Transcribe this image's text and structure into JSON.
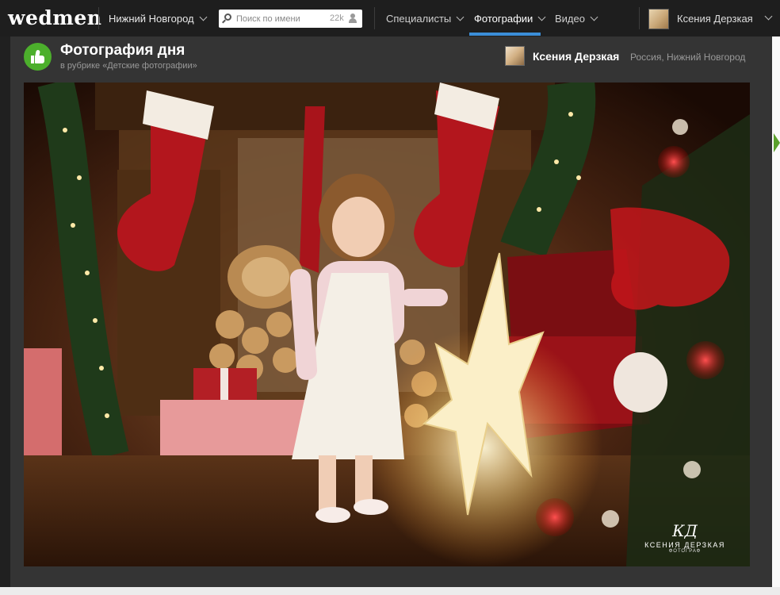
{
  "header": {
    "logo": "wedmen",
    "city": "Нижний Новгород",
    "search": {
      "placeholder": "Поиск по имени",
      "count": "22k"
    },
    "nav": [
      {
        "label": "Специалисты",
        "active": false
      },
      {
        "label": "Фотографии",
        "active": true
      },
      {
        "label": "Видео",
        "active": false
      }
    ],
    "account": {
      "name": "Ксения Дерзкая"
    },
    "accent_color": "#3b8ed8"
  },
  "content": {
    "title": "Фотография дня",
    "subtitle": "в рубрике «Детские фотографии»",
    "badge_color": "#4caf2c",
    "author": {
      "name": "Ксения Дерзкая",
      "location": "Россия, Нижний Новгород"
    }
  },
  "photo": {
    "watermark_initials": "КД",
    "watermark_name": "КСЕНИЯ ДЕРЗКАЯ",
    "watermark_caption": "ФОТОГРАФ"
  }
}
